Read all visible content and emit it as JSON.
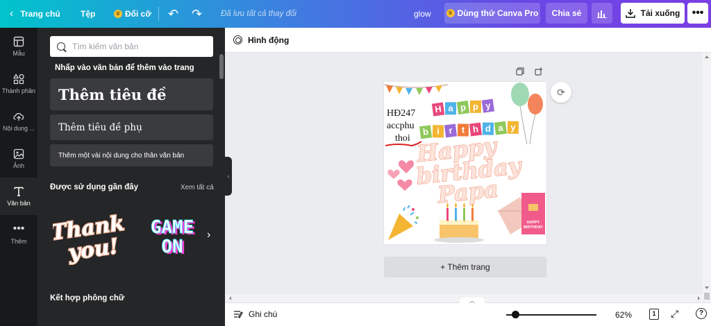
{
  "topbar": {
    "home_label": "Trang chủ",
    "file_label": "Tệp",
    "resize_label": "Đổi cỡ",
    "saved_status": "Đã lưu tất cả thay đổi",
    "design_title": "glow",
    "pro_label": "Dùng thử Canva Pro",
    "share_label": "Chia sẻ",
    "download_label": "Tải xuống",
    "more_label": "•••"
  },
  "rail": {
    "items": [
      {
        "label": "Mẫu",
        "icon": "template-icon"
      },
      {
        "label": "Thành phần",
        "icon": "elements-icon"
      },
      {
        "label": "Nội dung ...",
        "icon": "upload-icon"
      },
      {
        "label": "Ảnh",
        "icon": "photo-icon"
      },
      {
        "label": "Văn bản",
        "icon": "text-icon"
      },
      {
        "label": "Thêm",
        "icon": "more-icon"
      }
    ]
  },
  "panel": {
    "search_placeholder": "Tìm kiếm văn bản",
    "hint": "Nhấp vào văn bản để thêm vào trang",
    "heading_label": "Thêm tiêu đề",
    "subheading_label": "Thêm tiêu đề phụ",
    "body_label": "Thêm một vài nội dung cho thân văn bản",
    "recent_title": "Được sử dụng gần đây",
    "see_all": "Xem tất cả",
    "recent_styles": [
      {
        "line1": "Thank",
        "line2": "you!"
      },
      {
        "line1": "GAME",
        "line2": "ON"
      }
    ],
    "combos_title": "Kết hợp phông chữ"
  },
  "animate_label": "Hình động",
  "canvas": {
    "handwritten_lines": [
      "HĐ247",
      "accphu",
      "thoi"
    ],
    "happy_tiles": [
      "H",
      "a",
      "p",
      "p",
      "y"
    ],
    "birthday_tiles": [
      "b",
      "i",
      "r",
      "t",
      "h",
      "d",
      "a",
      "y"
    ],
    "script_lines": [
      "Happy",
      "birthday",
      "Papa"
    ],
    "card_text": [
      "HAPPY",
      "BIRTHDAY"
    ],
    "tile_colors": [
      "#e8477a",
      "#4fb3e8",
      "#8fc85a",
      "#f3b532",
      "#9a6ad9",
      "#f07c3a"
    ]
  },
  "add_page_label": "+ Thêm trang",
  "bottombar": {
    "notes_label": "Ghi chú",
    "zoom": "62%",
    "page_count": "1",
    "help_label": "?"
  },
  "colors": {
    "accent_gradient_start": "#00c4cc",
    "accent_gradient_end": "#7b3fe4",
    "panel_bg": "#252627",
    "rail_bg": "#18191b"
  }
}
